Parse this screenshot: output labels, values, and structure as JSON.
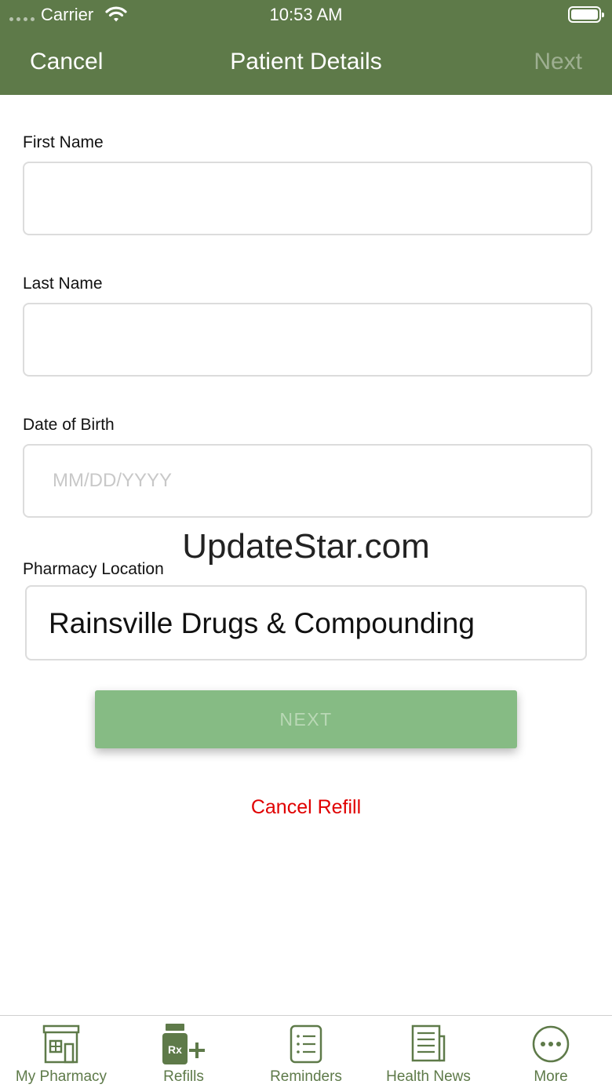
{
  "status_bar": {
    "carrier": "Carrier",
    "time": "10:53 AM"
  },
  "nav": {
    "cancel": "Cancel",
    "title": "Patient Details",
    "next": "Next"
  },
  "form": {
    "first_name": {
      "label": "First Name",
      "value": "",
      "placeholder": ""
    },
    "last_name": {
      "label": "Last Name",
      "value": "",
      "placeholder": ""
    },
    "dob": {
      "label": "Date of Birth",
      "value": "",
      "placeholder": "MM/DD/YYYY"
    },
    "pharmacy": {
      "label": "Pharmacy Location",
      "value": "Rainsville Drugs & Compounding"
    }
  },
  "watermark": "UpdateStar.com",
  "next_button": "NEXT",
  "cancel_refill": "Cancel Refill",
  "tabs": [
    {
      "label": "My Pharmacy",
      "icon": "pharmacy-store-icon"
    },
    {
      "label": "Refills",
      "icon": "rx-refill-icon"
    },
    {
      "label": "Reminders",
      "icon": "checklist-icon"
    },
    {
      "label": "Health News",
      "icon": "newspaper-icon"
    },
    {
      "label": "More",
      "icon": "more-dots-icon"
    }
  ],
  "colors": {
    "header": "#5e7a49",
    "next_button_bg": "#86bb84",
    "cancel_refill": "#e00000",
    "tab_icon": "#5e7a49"
  }
}
